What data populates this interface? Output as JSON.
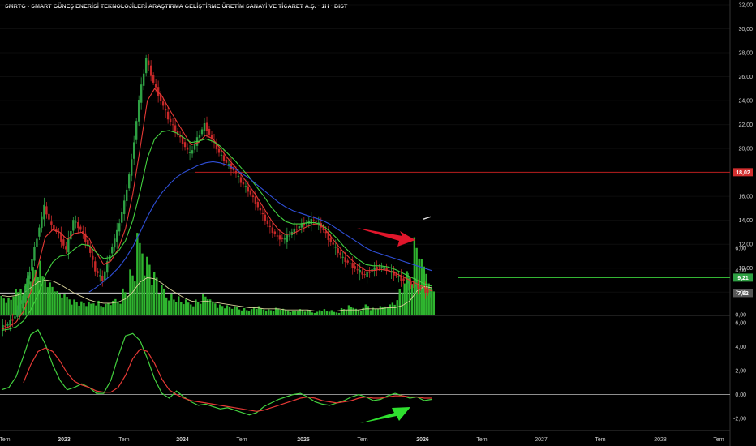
{
  "header": {
    "title": "SMRTG - SMART GÜNEŞ ENERİSİ TEKNOLOJİLERİ ARAŞTIRMA GELİŞTİRME ÜRETİM SANAYİ VE TİCARET A.Ş. · 1H · BIST"
  },
  "colors": {
    "background": "#000000",
    "candle_up": "#2ea043",
    "candle_down": "#c62828",
    "ema_fast": "#e53935",
    "ema_mid": "#43d13f",
    "ema_slow": "#2f4fd8",
    "volume": "#2fb52f",
    "volume_ma": "#d8d39a",
    "resistance_line": "#b71c1c",
    "support_line": "#3ccf3c",
    "arrow_red": "#e0162b",
    "arrow_green": "#2fe02f"
  },
  "price_axis": {
    "ticks": [
      "32,00",
      "30,00",
      "28,00",
      "26,00",
      "24,00",
      "22,00",
      "20,00",
      "18,00",
      "16,00",
      "14,00",
      "12,00",
      "10,00",
      "8,00"
    ],
    "ylim": [
      7,
      32
    ],
    "badges": [
      {
        "label": "18,02",
        "value": 18.02,
        "color": "#d32f2f"
      },
      {
        "label": "9,21",
        "value": 9.21,
        "color": "#2ea043"
      },
      {
        "label": "7,92",
        "value": 7.92,
        "color": "#555555"
      }
    ]
  },
  "volume_axis": {
    "ticks": [
      "6,00",
      "4,00",
      "2,00",
      "0,00"
    ]
  },
  "oscillator_axis": {
    "ticks": [
      "6,00",
      "4,00",
      "2,00",
      "0,00",
      "-2,00"
    ],
    "ylim": [
      -2.6,
      6.2
    ]
  },
  "time_axis": {
    "labels": [
      "Tem",
      "2023",
      "Tem",
      "2024",
      "Tem",
      "2025",
      "Tem",
      "2026",
      "Tem",
      "2027",
      "Tem",
      "2028",
      "Tem"
    ],
    "bold": [
      "2023",
      "2024",
      "2025",
      "2026"
    ]
  },
  "chart_data": {
    "type": "candlestick",
    "x_labels": [
      "Tem",
      "2023",
      "Tem",
      "2024",
      "Tem",
      "2025",
      "Tem",
      "2026",
      "Tem",
      "2027",
      "Tem",
      "2028",
      "Tem"
    ],
    "price_series": [
      {
        "name": "close",
        "values": [
          5.0,
          5.3,
          6.0,
          7.4,
          9.8,
          12.6,
          15.1,
          13.5,
          12.8,
          11.5,
          14.0,
          13.2,
          11.9,
          9.8,
          9.0,
          11.2,
          13.0,
          15.5,
          19.0,
          24.0,
          27.5,
          25.5,
          24.0,
          22.5,
          21.5,
          20.5,
          19.5,
          20.8,
          22.0,
          20.8,
          19.6,
          18.8,
          18.2,
          17.2,
          16.5,
          15.5,
          14.4,
          13.3,
          12.6,
          12.4,
          13.0,
          13.5,
          13.8,
          14.0,
          13.5,
          12.5,
          11.6,
          10.8,
          10.3,
          9.8,
          9.4,
          9.9,
          10.1,
          9.9,
          9.5,
          9.1,
          8.8,
          8.5,
          8.2,
          7.9
        ]
      },
      {
        "name": "ema_fast",
        "values": [
          4.9,
          5.1,
          5.5,
          6.4,
          8.0,
          10.2,
          12.6,
          13.2,
          13.0,
          12.4,
          12.9,
          13.0,
          12.5,
          11.3,
          10.3,
          10.6,
          11.6,
          13.3,
          16.2,
          20.0,
          24.0,
          25.0,
          24.4,
          23.3,
          22.3,
          21.3,
          20.3,
          20.5,
          21.1,
          20.8,
          20.0,
          19.2,
          18.5,
          17.7,
          16.9,
          16.0,
          15.0,
          14.0,
          13.2,
          12.8,
          12.9,
          13.2,
          13.5,
          13.7,
          13.5,
          12.8,
          12.0,
          11.3,
          10.7,
          10.2,
          9.8,
          9.8,
          9.9,
          9.8,
          9.6,
          9.3,
          9.0,
          8.7,
          8.4,
          8.1
        ]
      },
      {
        "name": "ema_mid",
        "values": [
          4.8,
          4.9,
          5.1,
          5.6,
          6.5,
          7.8,
          9.4,
          10.5,
          11.0,
          11.1,
          11.6,
          12.0,
          11.9,
          11.3,
          10.8,
          10.9,
          11.4,
          12.3,
          14.0,
          16.4,
          19.2,
          20.8,
          21.4,
          21.5,
          21.3,
          20.9,
          20.5,
          20.6,
          20.8,
          20.6,
          20.2,
          19.6,
          19.0,
          18.3,
          17.6,
          16.8,
          16.0,
          15.1,
          14.4,
          13.9,
          13.7,
          13.7,
          13.8,
          13.8,
          13.6,
          13.1,
          12.5,
          11.8,
          11.2,
          10.7,
          10.3,
          10.2,
          10.2,
          10.1,
          9.9,
          9.6,
          9.3,
          9.0,
          8.7,
          8.5
        ]
      },
      {
        "name": "ema_slow",
        "values": [
          null,
          null,
          null,
          null,
          null,
          null,
          null,
          null,
          null,
          null,
          null,
          null,
          8.0,
          8.4,
          8.9,
          9.4,
          10.0,
          10.8,
          11.8,
          13.0,
          14.3,
          15.4,
          16.3,
          17.0,
          17.6,
          18.0,
          18.3,
          18.6,
          18.8,
          18.9,
          18.8,
          18.6,
          18.3,
          17.9,
          17.5,
          17.0,
          16.5,
          16.0,
          15.5,
          15.1,
          14.8,
          14.6,
          14.4,
          14.2,
          14.0,
          13.7,
          13.3,
          12.9,
          12.5,
          12.1,
          11.7,
          11.4,
          11.2,
          11.0,
          10.8,
          10.6,
          10.4,
          10.2,
          10.0,
          9.8
        ]
      }
    ],
    "volume": {
      "values": [
        1.6,
        1.4,
        2.0,
        2.6,
        3.8,
        4.1,
        3.4,
        2.7,
        1.9,
        1.6,
        1.3,
        1.1,
        1.0,
        1.2,
        0.9,
        1.1,
        1.4,
        2.2,
        3.6,
        6.2,
        4.8,
        3.4,
        2.3,
        1.8,
        1.5,
        1.2,
        1.1,
        1.3,
        1.7,
        1.2,
        0.9,
        0.8,
        0.7,
        0.6,
        0.5,
        0.7,
        0.6,
        0.5,
        0.6,
        0.5,
        0.4,
        0.5,
        0.4,
        0.3,
        0.5,
        0.4,
        0.3,
        0.6,
        0.8,
        0.5,
        0.9,
        0.6,
        0.7,
        0.9,
        1.2,
        2.4,
        3.8,
        6.4,
        4.4,
        2.4
      ],
      "ma": [
        1.8,
        1.7,
        1.8,
        2.0,
        2.5,
        3.0,
        3.2,
        3.1,
        2.8,
        2.4,
        2.0,
        1.7,
        1.4,
        1.2,
        1.1,
        1.1,
        1.2,
        1.5,
        2.1,
        3.0,
        3.4,
        3.3,
        2.9,
        2.4,
        2.0,
        1.6,
        1.3,
        1.2,
        1.3,
        1.2,
        1.1,
        1.0,
        0.9,
        0.8,
        0.7,
        0.7,
        0.6,
        0.6,
        0.6,
        0.5,
        0.5,
        0.5,
        0.5,
        0.4,
        0.4,
        0.4,
        0.4,
        0.5,
        0.5,
        0.5,
        0.6,
        0.6,
        0.6,
        0.7,
        0.7,
        0.9,
        1.3,
        2.2,
        2.6,
        2.5
      ]
    },
    "oscillator": {
      "green": [
        0.4,
        0.6,
        1.5,
        3.2,
        5.0,
        5.4,
        4.2,
        2.5,
        1.2,
        0.4,
        0.6,
        0.9,
        0.6,
        0.1,
        0.1,
        1.2,
        3.2,
        4.9,
        5.1,
        4.5,
        3.0,
        1.3,
        0.1,
        -0.3,
        0.3,
        -0.2,
        -0.6,
        -0.9,
        -0.8,
        -1.0,
        -1.2,
        -1.1,
        -1.3,
        -1.5,
        -1.7,
        -1.5,
        -1.0,
        -0.7,
        -0.4,
        -0.2,
        0.0,
        0.1,
        -0.2,
        -0.6,
        -0.8,
        -0.9,
        -0.7,
        -0.5,
        -0.2,
        0.0,
        -0.2,
        -0.5,
        -0.4,
        -0.1,
        0.1,
        -0.1,
        -0.3,
        -0.2,
        -0.5,
        -0.4
      ],
      "red": [
        null,
        null,
        null,
        1.0,
        2.5,
        3.6,
        3.9,
        3.6,
        2.8,
        1.8,
        1.1,
        0.8,
        0.6,
        0.3,
        0.2,
        0.2,
        0.6,
        1.6,
        3.0,
        3.8,
        3.6,
        2.6,
        1.3,
        0.4,
        0.0,
        -0.3,
        -0.5,
        -0.6,
        -0.7,
        -0.8,
        -0.9,
        -1.0,
        -1.1,
        -1.2,
        -1.3,
        -1.4,
        -1.3,
        -1.1,
        -0.9,
        -0.7,
        -0.5,
        -0.3,
        -0.2,
        -0.3,
        -0.5,
        -0.6,
        -0.7,
        -0.6,
        -0.5,
        -0.3,
        -0.2,
        -0.3,
        -0.3,
        -0.2,
        -0.1,
        -0.1,
        -0.2,
        -0.2,
        -0.3,
        -0.3
      ]
    },
    "horizontal_levels": [
      18.02,
      9.21,
      7.92
    ],
    "annotations": [
      "red-arrow-down-right",
      "green-arrow-up-right"
    ]
  }
}
